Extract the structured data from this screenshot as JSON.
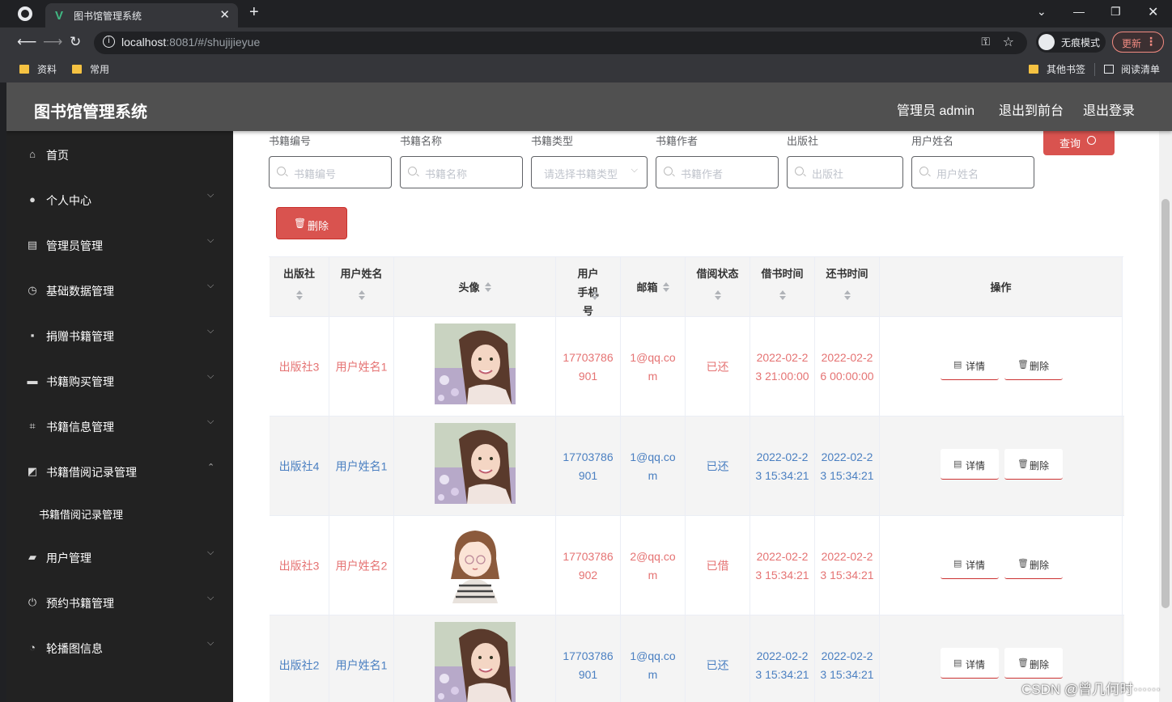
{
  "browser": {
    "tab_title": "图书馆管理系统",
    "new_tab": "+",
    "window_controls": {
      "dropdown": "⌄",
      "minimize": "—",
      "restore": "❐",
      "close": "✕"
    },
    "url_host": "localhost",
    "url_rest": ":8081/#/shujijieyue",
    "incognito_label": "无痕模式",
    "update_label": "更新",
    "bookmarks": [
      "资料",
      "常用"
    ],
    "bookmarks_right": [
      "其他书签",
      "阅读清单"
    ]
  },
  "header": {
    "title": "图书馆管理系统",
    "links": [
      "管理员 admin",
      "退出到前台",
      "退出登录"
    ]
  },
  "sidebar": {
    "items": [
      {
        "label": "首页",
        "icon": "home-icon",
        "glyph": "⌂",
        "arrow": ""
      },
      {
        "label": "个人中心",
        "icon": "user-icon",
        "glyph": "●",
        "arrow": "⌵"
      },
      {
        "label": "管理员管理",
        "icon": "clipboard-icon",
        "glyph": "▤",
        "arrow": "⌵"
      },
      {
        "label": "基础数据管理",
        "icon": "clock-icon",
        "glyph": "◷",
        "arrow": "⌵"
      },
      {
        "label": "捐赠书籍管理",
        "icon": "chat-icon",
        "glyph": "▪",
        "arrow": "⌵"
      },
      {
        "label": "书籍购买管理",
        "icon": "briefcase-icon",
        "glyph": "▬",
        "arrow": "⌵"
      },
      {
        "label": "书籍信息管理",
        "icon": "crop-icon",
        "glyph": "⌗",
        "arrow": "⌵"
      },
      {
        "label": "书籍借阅记录管理",
        "icon": "chart-icon",
        "glyph": "◩",
        "arrow": "⌃"
      },
      {
        "label": "用户管理",
        "icon": "ticket-icon",
        "glyph": "▰",
        "arrow": "⌵"
      },
      {
        "label": "预约书籍管理",
        "icon": "power-icon",
        "glyph": "⏻",
        "arrow": "⌵"
      },
      {
        "label": "轮播图信息",
        "icon": "gauge-icon",
        "glyph": "◔",
        "arrow": "⌵"
      }
    ],
    "submenu": "书籍借阅记录管理"
  },
  "filters": [
    {
      "label": "书籍编号",
      "placeholder": "书籍编号",
      "kind": "search"
    },
    {
      "label": "书籍名称",
      "placeholder": "书籍名称",
      "kind": "search"
    },
    {
      "label": "书籍类型",
      "placeholder": "请选择书籍类型",
      "kind": "select"
    },
    {
      "label": "书籍作者",
      "placeholder": "书籍作者",
      "kind": "search"
    },
    {
      "label": "出版社",
      "placeholder": "出版社",
      "kind": "search"
    },
    {
      "label": "用户姓名",
      "placeholder": "用户姓名",
      "kind": "search"
    }
  ],
  "query_label": "查询",
  "delete_label": "删除",
  "table": {
    "columns": [
      "出版社",
      "用户姓名",
      "头像",
      "用户手机号",
      "邮箱",
      "借阅状态",
      "借书时间",
      "还书时间",
      "操作"
    ],
    "action_labels": {
      "detail": "详情",
      "delete": "删除"
    },
    "rows": [
      {
        "publisher": "出版社3",
        "user": "用户姓名1",
        "avatar": "photo",
        "phone": "17703786901",
        "email": "1@qq.com",
        "status": "已还",
        "borrow": "2022-02-23 21:00:00",
        "ret": "2022-02-26 00:00:00",
        "color": "#e57373"
      },
      {
        "publisher": "出版社4",
        "user": "用户姓名1",
        "avatar": "photo",
        "phone": "17703786901",
        "email": "1@qq.com",
        "status": "已还",
        "borrow": "2022-02-23 15:34:21",
        "ret": "2022-02-23 15:34:21",
        "color": "#4a7fc1"
      },
      {
        "publisher": "出版社3",
        "user": "用户姓名2",
        "avatar": "cartoon",
        "phone": "17703786902",
        "email": "2@qq.com",
        "status": "已借",
        "borrow": "2022-02-23 15:34:21",
        "ret": "2022-02-23 15:34:21",
        "color": "#e57373"
      },
      {
        "publisher": "出版社2",
        "user": "用户姓名1",
        "avatar": "photo",
        "phone": "17703786901",
        "email": "1@qq.com",
        "status": "已还",
        "borrow": "2022-02-23 15:34:21",
        "ret": "2022-02-23 15:34:21",
        "color": "#4a7fc1"
      }
    ]
  },
  "watermark": "CSDN @曾几何时⋯⋯"
}
